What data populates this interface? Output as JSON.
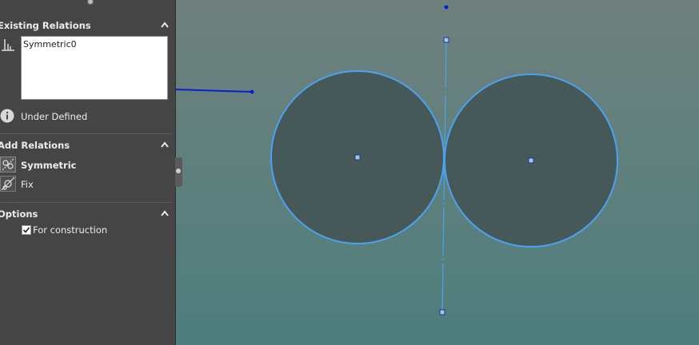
{
  "property_manager": {
    "existing_relations": {
      "title": "Existing Relations",
      "items": [
        "Symmetric0"
      ],
      "status": "Under Defined"
    },
    "add_relations": {
      "title": "Add Relations",
      "items": [
        {
          "label": "Symmetric",
          "icon": "symmetric-icon",
          "selected": true
        },
        {
          "label": "Fix",
          "icon": "fix-icon",
          "selected": false
        }
      ]
    },
    "options": {
      "title": "Options",
      "for_construction": {
        "label": "For construction",
        "checked": true
      }
    }
  },
  "colors": {
    "panel_bg": "#454545",
    "sketch_blue": "#4aa3f0",
    "point_blue": "#0a1fcc",
    "circle_fill": "#465958"
  }
}
